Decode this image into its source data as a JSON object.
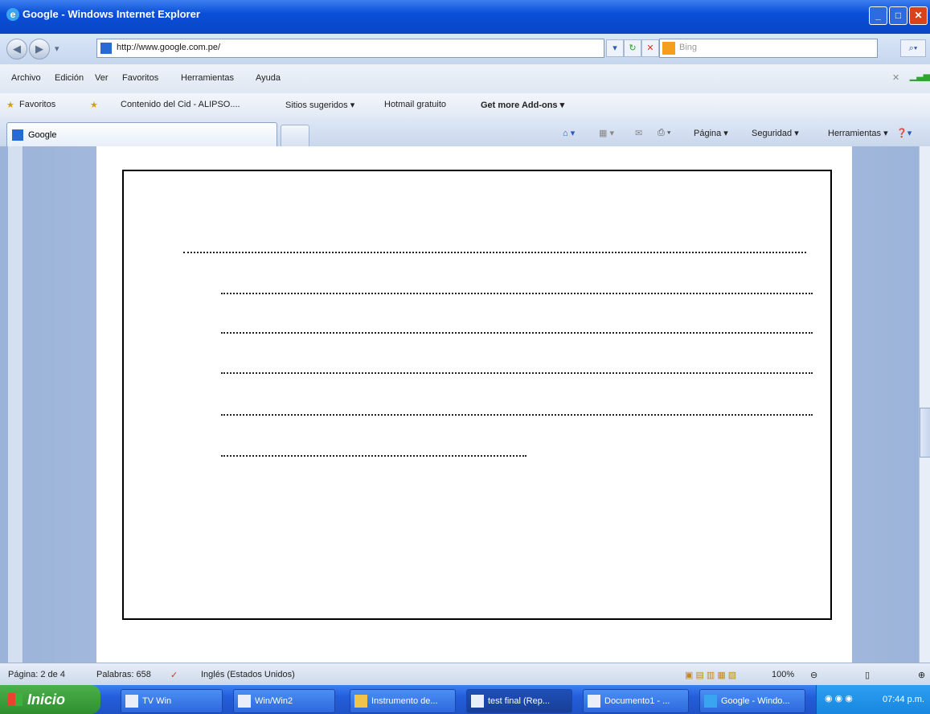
{
  "window": {
    "title": "Google - Windows Internet Explorer",
    "min": "_",
    "max": "□",
    "close": "✕"
  },
  "address": {
    "url": "http://www.google.com.pe/",
    "search_placeholder": "Bing"
  },
  "menu": [
    "Archivo",
    "Edición",
    "Ver",
    "Favoritos",
    "Herramientas",
    "Ayuda"
  ],
  "favorites": {
    "label": "Favoritos",
    "items": [
      "Contenido del Cid - ALIPSO....",
      "Sitios sugeridos ▾",
      "Hotmail gratuito",
      "Get more Add-ons ▾"
    ]
  },
  "tab": {
    "label": "Google"
  },
  "commands": [
    "Página ▾",
    "Seguridad ▾",
    "Herramientas ▾"
  ],
  "status": {
    "page": "Página: 2 de 4",
    "words": "Palabras: 658",
    "language": "Inglés (Estados Unidos)",
    "zoom": "100%"
  },
  "taskbar": {
    "start": "Inicio",
    "tasks": [
      "TV Win",
      "Win/Win2",
      "Instrumento de...",
      "test final (Rep...",
      "Documento1 - ...",
      "Google - Windo..."
    ],
    "clock": "07:44 p.m."
  },
  "document": {
    "dotted_lines": 6
  }
}
